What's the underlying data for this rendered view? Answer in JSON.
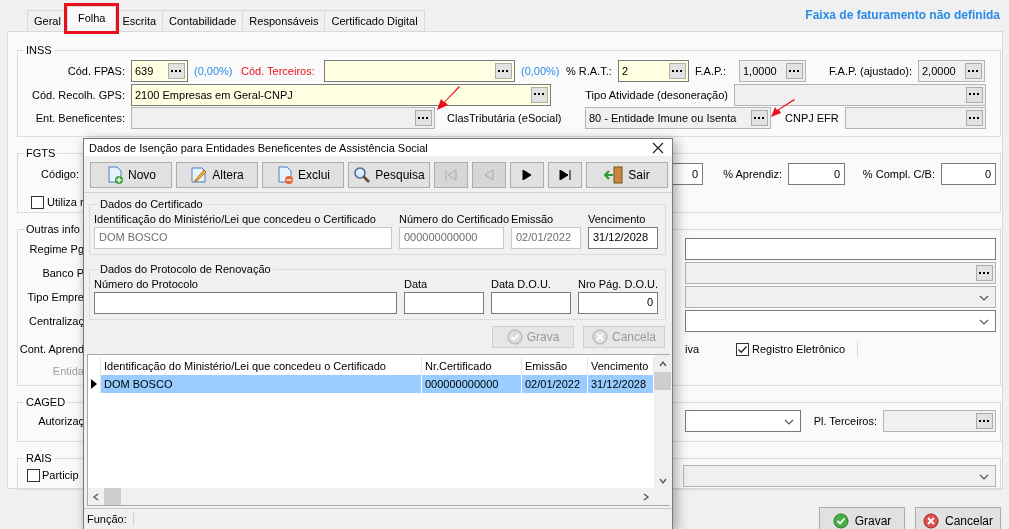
{
  "tabs": [
    {
      "label": "Geral",
      "selected": false,
      "highlighted": false
    },
    {
      "label": "Folha",
      "selected": true,
      "highlighted": true
    },
    {
      "label": "Escrita",
      "selected": false,
      "highlighted": false
    },
    {
      "label": "Contabilidade",
      "selected": false,
      "highlighted": false
    },
    {
      "label": "Responsáveis",
      "selected": false,
      "highlighted": false
    },
    {
      "label": "Certificado Digital",
      "selected": false,
      "highlighted": false
    }
  ],
  "notice": "Faixa de faturamento não definida",
  "inss": {
    "title": "INSS",
    "fpas": {
      "label": "Cód. FPAS:",
      "invalid": false,
      "field": {
        "kind": "lookup",
        "required": true,
        "value": "639"
      },
      "rate": "(0,00%)"
    },
    "third_parties": {
      "label": "Cód. Terceiros:",
      "invalid": true,
      "field": {
        "kind": "lookup",
        "required": true
      },
      "rate": "(0,00%)"
    },
    "rat": {
      "label": "% R.A.T.:",
      "field": {
        "kind": "lookup",
        "required": true,
        "value": "2"
      }
    },
    "fap": {
      "label": "F.A.P.:",
      "field": {
        "kind": "lookup",
        "required": false,
        "disabled": true,
        "value": "1,0000"
      }
    },
    "fap_adjusted": {
      "label": "F.A.P. (ajustado):",
      "field": {
        "kind": "lookup",
        "required": false,
        "disabled": true,
        "value": "2,0000"
      }
    },
    "gps": {
      "label": "Cód. Recolh. GPS:",
      "field": {
        "kind": "lookup",
        "required": true,
        "value": "2100 Empresas em Geral-CNPJ"
      }
    },
    "activity_type": {
      "label": "Tipo Atividade (desoneração)",
      "field": {
        "kind": "lookup",
        "required": false,
        "disabled": true
      }
    },
    "beneficent": {
      "label": "Ent. Beneficentes:",
      "pointer_arrow": true,
      "field": {
        "kind": "lookup",
        "required": false,
        "disabled": true
      }
    },
    "tax_class": {
      "label": "ClasTributária (eSocial)",
      "pointer_arrow": true,
      "field": {
        "kind": "lookup",
        "required": false,
        "disabled": true,
        "value": "80 - Entidade Imune ou Isenta"
      }
    },
    "cnpj_efr": {
      "label": "CNPJ EFR",
      "field": {
        "kind": "lookup",
        "required": false,
        "disabled": true
      }
    }
  },
  "fgts": {
    "title": "FGTS",
    "code_label": "Código:",
    "code_field": {
      "required": false,
      "disabled": false,
      "value": "0"
    },
    "apprentice": {
      "label": "% Aprendiz:",
      "field": {
        "required": false,
        "disabled": false,
        "value": "0"
      }
    },
    "complement": {
      "label": "% Compl. C/B:",
      "field": {
        "required": false,
        "disabled": false,
        "value": "0"
      }
    },
    "option": {
      "label": "Utiliza r",
      "checked": false
    }
  },
  "other": {
    "title": "Outras info",
    "labels": [
      {
        "text": "Regime Pg",
        "disabled": false
      },
      {
        "text": "Banco P",
        "disabled": false
      },
      {
        "text": "Tipo Empre",
        "disabled": false
      },
      {
        "text": "Centralizaç",
        "disabled": false
      },
      {
        "text": "Cont. Aprend",
        "disabled": false
      },
      {
        "text": "Entida",
        "disabled": true
      }
    ],
    "fields": [
      {
        "kind": "text",
        "required": false,
        "disabled": false
      },
      {
        "kind": "lookup",
        "required": false,
        "disabled": true
      },
      {
        "kind": "dropdown",
        "required": false,
        "disabled": true
      },
      {
        "kind": "dropdown",
        "required": false,
        "disabled": false
      }
    ],
    "option_tail": "iva",
    "registro": {
      "label": "Registro Eletrônico",
      "checked": true
    }
  },
  "caged": {
    "title": "CAGED",
    "label": "Autorizaç",
    "field": {
      "kind": "dropdown",
      "required": false,
      "disabled": false
    },
    "third_label": "Pl. Terceiros:",
    "third_field": {
      "kind": "lookup",
      "required": false,
      "disabled": true
    }
  },
  "rais": {
    "title": "RAIS",
    "option": {
      "label": "Particip",
      "checked": false
    },
    "field": {
      "kind": "dropdown",
      "required": false,
      "disabled": true
    }
  },
  "footer": [
    {
      "kind": "save",
      "label": "Gravar"
    },
    {
      "kind": "cancel",
      "label": "Cancelar"
    }
  ],
  "dialog": {
    "title": "Dados de Isenção para Entidades Beneficentes de Assistência Social",
    "toolbar": [
      {
        "kind": "new",
        "label": "Novo",
        "disabled": false
      },
      {
        "kind": "edit",
        "label": "Altera",
        "disabled": false
      },
      {
        "kind": "delete",
        "label": "Exclui",
        "disabled": false
      },
      {
        "kind": "search",
        "label": "Pesquisa",
        "disabled": false
      },
      {
        "kind": "first",
        "disabled": true
      },
      {
        "kind": "previous",
        "disabled": true
      },
      {
        "kind": "next",
        "disabled": false
      },
      {
        "kind": "last",
        "disabled": false
      },
      {
        "kind": "exit",
        "label": "Sair",
        "disabled": false
      }
    ],
    "certificate": {
      "title": "Dados do Certificado",
      "fields": [
        {
          "label": "Identificação do Ministério/Lei que concedeu o Certificado",
          "value": "DOM BOSCO",
          "disabled": true
        },
        {
          "label": "Número do Certificado",
          "value": "000000000000",
          "disabled": true
        },
        {
          "label": "Emissão",
          "value": "02/01/2022",
          "disabled": true
        },
        {
          "label": "Vencimento",
          "value": "31/12/2028",
          "disabled": false
        }
      ]
    },
    "renewal": {
      "title": "Dados do Protocolo de Renovação",
      "fields": [
        {
          "label": "Número do Protocolo",
          "disabled": false
        },
        {
          "label": "Data",
          "disabled": false
        },
        {
          "label": "Data D.O.U.",
          "disabled": false
        },
        {
          "label": "Nro Pág. D.O.U.",
          "value": "0",
          "disabled": false
        }
      ]
    },
    "actions": [
      {
        "kind": "save",
        "label": "Grava",
        "disabled": true
      },
      {
        "kind": "cancel",
        "label": "Cancela",
        "disabled": true
      }
    ],
    "grid": {
      "columns": [
        "Identificação do Ministério/Lei que concedeu o Certificado",
        "Nr.Certificado",
        "Emissão",
        "Vencimento"
      ],
      "rows": [
        {
          "cells": [
            "DOM BOSCO",
            "000000000000",
            "02/01/2022",
            "31/12/2028"
          ],
          "selected": true
        }
      ]
    },
    "status_label": "Função:"
  }
}
